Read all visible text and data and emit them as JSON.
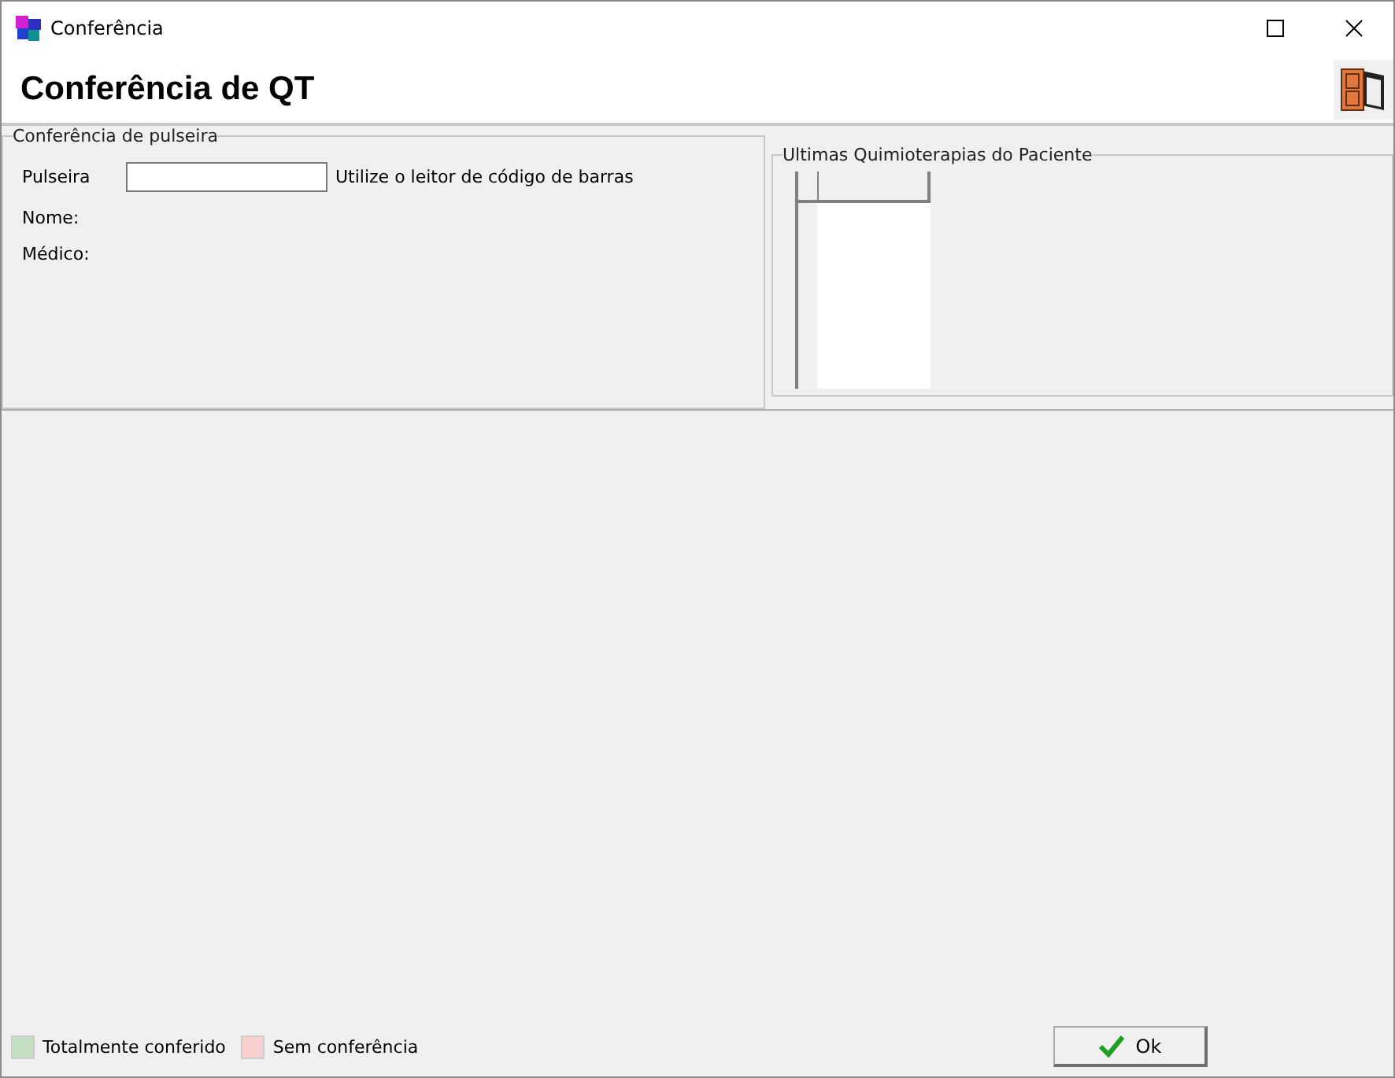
{
  "window": {
    "title": "Conferência"
  },
  "header": {
    "title": "Conferência de QT"
  },
  "bracelet_group": {
    "title": "Conferência de pulseira",
    "field_label": "Pulseira",
    "hint": "Utilize o leitor de código de barras",
    "labels": [
      "Nome:",
      "Médico:"
    ]
  },
  "history_group": {
    "title": "Ultimas Quimioterapias do Paciente"
  },
  "legend": [
    {
      "label": "Totalmente conferido",
      "color": "#c6e0c6"
    },
    {
      "label": "Sem conferência",
      "color": "#f8d0d0"
    }
  ],
  "ok_button": {
    "label": "Ok"
  }
}
